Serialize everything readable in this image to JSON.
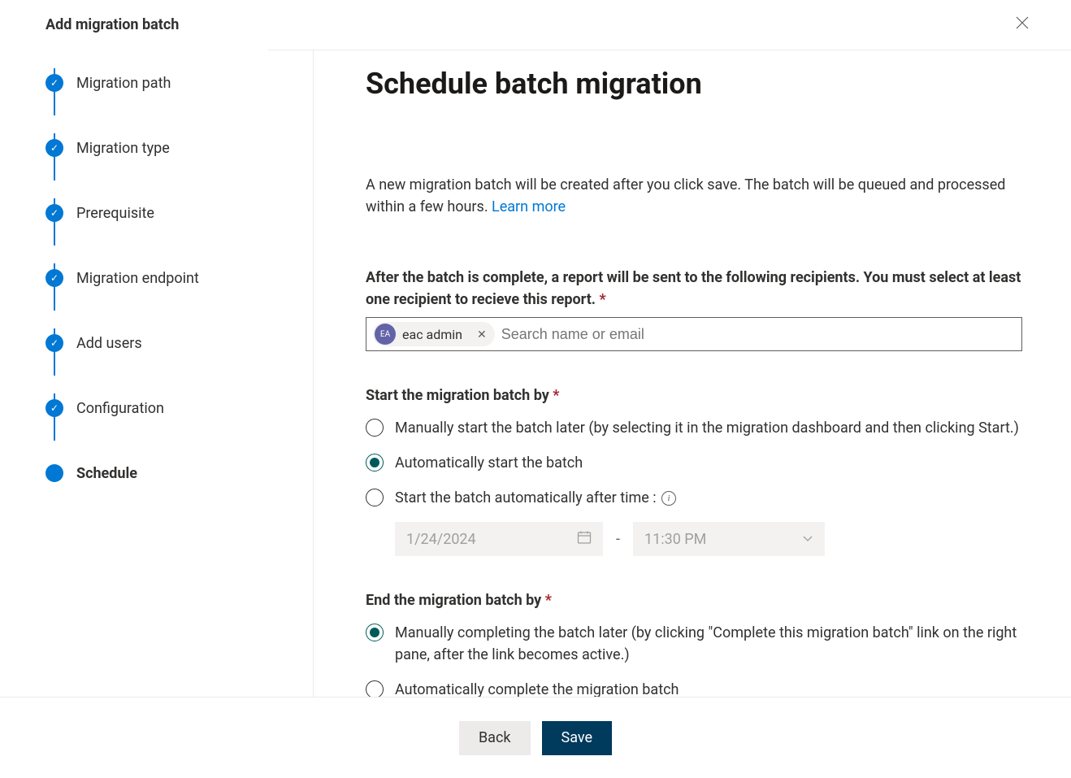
{
  "header": {
    "title": "Add migration batch"
  },
  "steps": [
    {
      "label": "Migration path",
      "state": "done"
    },
    {
      "label": "Migration type",
      "state": "done"
    },
    {
      "label": "Prerequisite",
      "state": "done"
    },
    {
      "label": "Migration endpoint",
      "state": "done"
    },
    {
      "label": "Add users",
      "state": "done"
    },
    {
      "label": "Configuration",
      "state": "done"
    },
    {
      "label": "Schedule",
      "state": "current"
    }
  ],
  "main": {
    "title": "Schedule batch migration",
    "description_pre": "A new migration batch will be created after you click save. The batch will be queued and processed within a few hours. ",
    "learn_more": "Learn more",
    "recipients": {
      "label": "After the batch is complete, a report will be sent to the following recipients. You must select at least one recipient to recieve this report.",
      "chip": {
        "initials": "EA",
        "name": "eac admin"
      },
      "placeholder": "Search name or email"
    },
    "start": {
      "heading": "Start the migration batch by",
      "opt_manual": "Manually start the batch later (by selecting it in the migration dashboard and then clicking Start.)",
      "opt_auto": "Automatically start the batch",
      "opt_after": "Start the batch automatically after time :",
      "date": "1/24/2024",
      "time": "11:30 PM"
    },
    "end": {
      "heading": "End the migration batch by",
      "opt_manual": "Manually completing the batch later (by clicking \"Complete this migration batch\" link on the right pane, after the link becomes active.)",
      "opt_auto": "Automatically complete the migration batch"
    }
  },
  "footer": {
    "back": "Back",
    "save": "Save"
  }
}
